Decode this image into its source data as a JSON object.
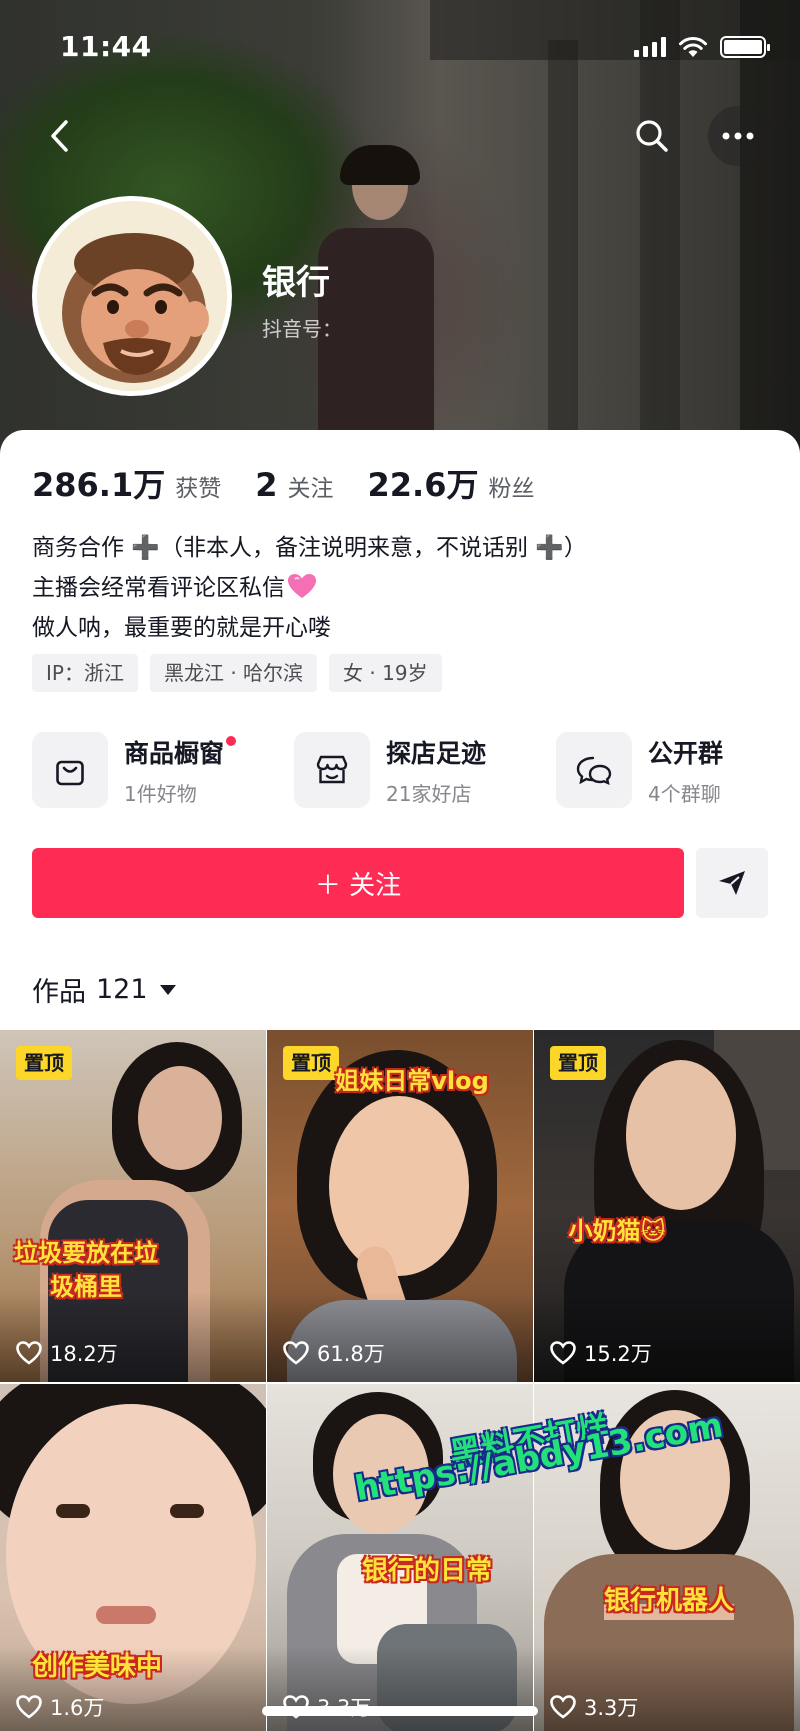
{
  "status_bar": {
    "time": "11:44"
  },
  "profile": {
    "name": "银行",
    "douyin_id_label": "抖音号：",
    "stats": [
      {
        "value": "286.1万",
        "label": "获赞"
      },
      {
        "value": "2",
        "label": "关注"
      },
      {
        "value": "22.6万",
        "label": "粉丝"
      }
    ],
    "bio": [
      "商务合作 ➕（非本人，备注说明来意，不说话别 ➕）",
      "主播会经常看评论区私信",
      "做人呐，最重要的就是开心喽"
    ],
    "tags": [
      "IP：浙江",
      "黑龙江 · 哈尔滨",
      "女 · 19岁"
    ]
  },
  "services": [
    {
      "title": "商品橱窗",
      "sub": "1件好物",
      "icon": "shopping-bag-icon",
      "dot": true
    },
    {
      "title": "探店足迹",
      "sub": "21家好店",
      "icon": "storefront-icon",
      "dot": false
    },
    {
      "title": "公开群",
      "sub": "4个群聊",
      "icon": "chat-bubbles-icon",
      "dot": false
    }
  ],
  "actions": {
    "follow_label": "＋ 关注"
  },
  "works": {
    "label": "作品",
    "count": "121"
  },
  "videos": [
    {
      "pinned": "置顶",
      "caption": "垃圾要放在垃\n圾桶里",
      "likes": "18.2万"
    },
    {
      "pinned": "置顶",
      "caption": "姐妹日常vlog",
      "likes": "61.8万"
    },
    {
      "pinned": "置顶",
      "caption": "小奶猫🐱",
      "likes": "15.2万"
    },
    {
      "pinned": "",
      "caption": "创作美味中",
      "likes": "1.6万"
    },
    {
      "pinned": "",
      "caption": "银行的日常",
      "likes": "3.3万"
    },
    {
      "pinned": "",
      "caption": "银行机器人",
      "likes": "3.3万"
    }
  ],
  "watermark": {
    "line1": "黑料不打烊",
    "line2": "https://abdy13.com"
  },
  "colors": {
    "accent": "#fe2c55",
    "pin_badge": "#fcd628",
    "caption_text": "#ffe23a"
  }
}
